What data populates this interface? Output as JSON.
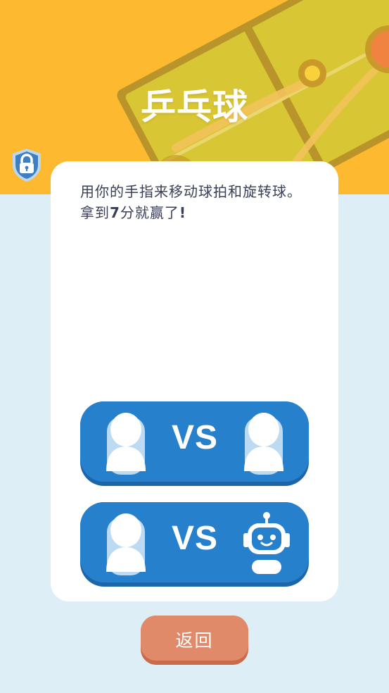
{
  "header": {
    "title": "乒乓球",
    "background_color": "#fdb92f",
    "decoration": "ping-pong-table"
  },
  "lock": {
    "icon": "lock-icon",
    "color": "#3f7fbf"
  },
  "card": {
    "instructions_part1": "用你的手指来移动球拍和旋转球。拿到",
    "instructions_score": "7",
    "instructions_part2": "分就赢了",
    "instructions_end": "!"
  },
  "modes": [
    {
      "vs_label": "VS",
      "left_icon": "person-icon",
      "right_icon": "person-icon"
    },
    {
      "vs_label": "VS",
      "left_icon": "person-icon",
      "right_icon": "robot-icon"
    }
  ],
  "back_button": {
    "label": "返回",
    "color": "#e08a6a"
  },
  "colors": {
    "page_background": "#deeef7",
    "button_blue": "#2680cc",
    "text_dark": "#3a3f58"
  }
}
